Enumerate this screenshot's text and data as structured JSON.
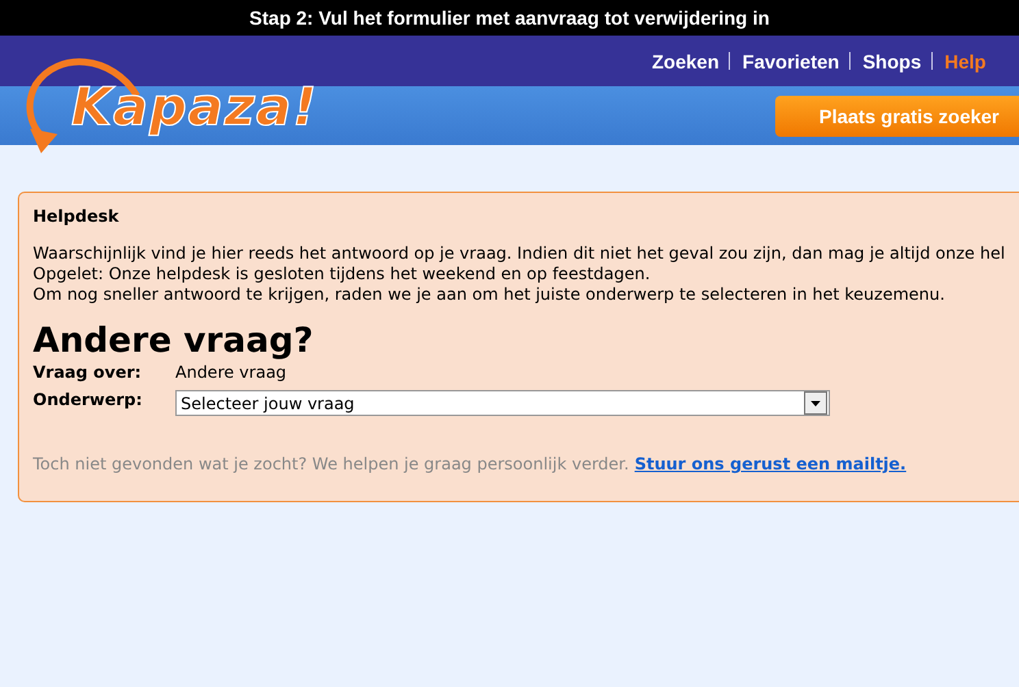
{
  "caption": "Stap 2: Vul het formulier met aanvraag tot verwijdering in",
  "logo": {
    "text": "Kapaza!"
  },
  "nav": [
    {
      "label": "Zoeken",
      "selected": false
    },
    {
      "label": "Favorieten",
      "selected": false
    },
    {
      "label": "Shops",
      "selected": false
    },
    {
      "label": "Help",
      "selected": true
    }
  ],
  "cta_button": "Plaats gratis zoeker",
  "panel": {
    "title": "Helpdesk",
    "paragraphs": [
      "Waarschijnlijk vind je hier reeds het antwoord op je vraag. Indien dit niet het geval zou zijn, dan mag je altijd onze hel",
      "Opgelet: Onze helpdesk is gesloten tijdens het weekend en op feestdagen.",
      "Om nog sneller antwoord te krijgen, raden we je aan om het juiste onderwerp te selecteren in het keuzemenu."
    ],
    "heading": "Andere vraag?",
    "fields": [
      {
        "kind": "text",
        "label": "Vraag over:",
        "value": "Andere vraag"
      },
      {
        "kind": "select",
        "label": "Onderwerp:",
        "value": "Selecteer jouw vraag"
      }
    ],
    "footer_text": "Toch niet gevonden wat je zocht? We helpen je graag persoonlijk verder.",
    "footer_link": "Stuur ons gerust een mailtje."
  }
}
